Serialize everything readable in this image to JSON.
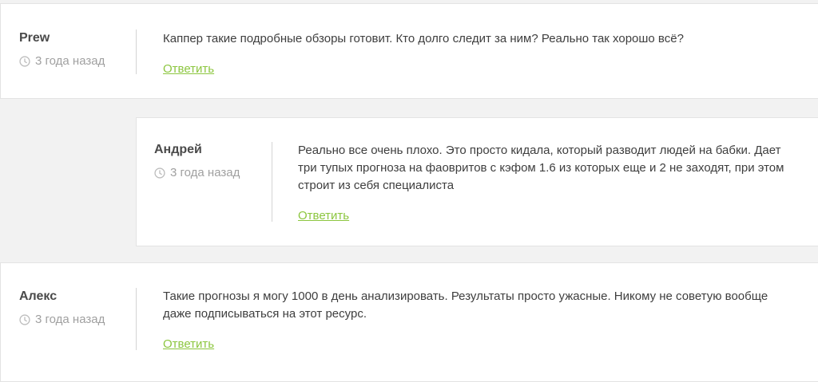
{
  "comments": [
    {
      "author": "Prew",
      "time": "3 года назад",
      "text": "Каппер такие подробные обзоры готовит. Кто долго следит за ним? Реально так хорошо всё?",
      "reply": "Ответить"
    },
    {
      "author": "Андрей",
      "time": "3 года назад",
      "text_lines": [
        "Реально все очень плохо. Это просто кидала, который разводит людей на бабки. Дает",
        "три тупых прогноза на фаовритов с кэфом 1.6 из которых еще и 2 не заходят, при этом",
        "строит из себя специалиста"
      ],
      "reply": "Ответить"
    },
    {
      "author": "Алекс",
      "time": "3 года назад",
      "text_lines": [
        "Такие прогнозы я могу 1000 в день анализировать. Результаты просто ужасные. Никому не советую вообще",
        "даже подписываться на этот ресурс."
      ],
      "reply": "Ответить"
    }
  ],
  "icons": {
    "clock": "clock-icon"
  },
  "colors": {
    "reply_link": "#8cc63f",
    "author": "#4a4a4a",
    "time": "#a0a0a0"
  }
}
